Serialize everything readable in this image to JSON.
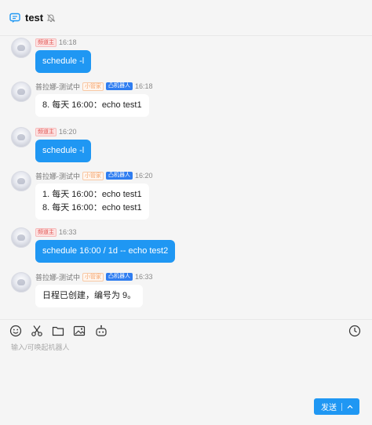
{
  "header": {
    "title": "test"
  },
  "messages": [
    {
      "tag": "频道主",
      "time": "16:18",
      "text": "schedule -l"
    },
    {
      "sender": "普拉娜-测试中",
      "tag": "小管家",
      "robot": "机器人",
      "time": "16:18",
      "lines": [
        "8. 每天 16:00：echo test1"
      ]
    },
    {
      "tag": "频道主",
      "time": "16:20",
      "text": "schedule -l"
    },
    {
      "sender": "普拉娜-测试中",
      "tag": "小管家",
      "robot": "机器人",
      "time": "16:20",
      "lines": [
        "1. 每天 16:00：echo test1",
        "8. 每天 16:00：echo test1"
      ]
    },
    {
      "tag": "频道主",
      "time": "16:33",
      "text": "schedule 16:00 / 1d -- echo test2"
    },
    {
      "sender": "普拉娜-测试中",
      "tag": "小管家",
      "robot": "机器人",
      "time": "16:33",
      "lines": [
        "日程已创建，编号为 9。"
      ]
    }
  ],
  "composer": {
    "placeholder": "输入/可唤起机器人",
    "send_label": "发送"
  },
  "icons": [
    "chat-icon",
    "mute-icon",
    "emoji-icon",
    "scissors-icon",
    "folder-icon",
    "image-icon",
    "robot-icon",
    "clock-icon",
    "chevron-up-icon"
  ],
  "colors": {
    "accent": "#1f97f3",
    "robot_tag": "#2f7df0",
    "owner_tag": "#e0524f",
    "manager_tag": "#f5a36a"
  }
}
